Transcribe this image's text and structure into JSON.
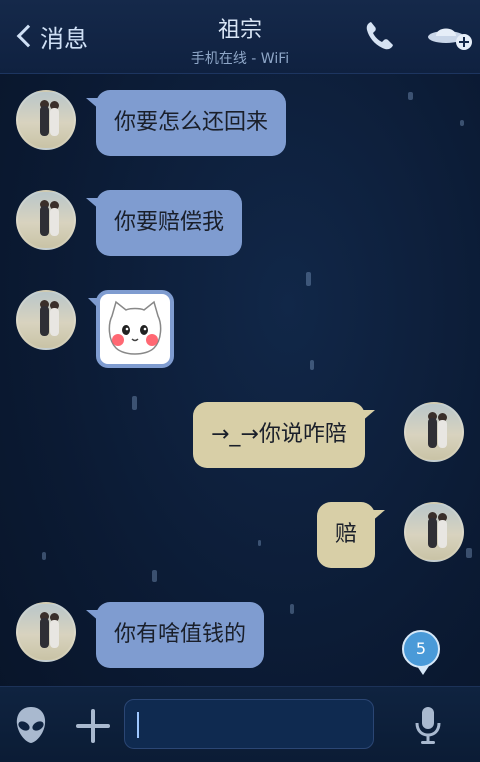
{
  "header": {
    "back_label": "消息",
    "title": "祖宗",
    "subtitle": "手机在线 - WiFi"
  },
  "messages": [
    {
      "side": "left",
      "type": "text",
      "text": "你要怎么还回来"
    },
    {
      "side": "left",
      "type": "text",
      "text": "你要赔偿我"
    },
    {
      "side": "left",
      "type": "sticker",
      "icon": "cat-face-sticker"
    },
    {
      "side": "right",
      "type": "text",
      "text": "→_→你说咋陪"
    },
    {
      "side": "right",
      "type": "text",
      "text": "赔"
    },
    {
      "side": "left",
      "type": "text",
      "text": "你有啥值钱的"
    }
  ],
  "unread_badge": {
    "count": "5"
  },
  "input": {
    "value": "",
    "placeholder": ""
  },
  "colors": {
    "left_bubble": "#7f9cd0",
    "right_bubble": "#d8cfa7",
    "background": "#0b1a33"
  }
}
